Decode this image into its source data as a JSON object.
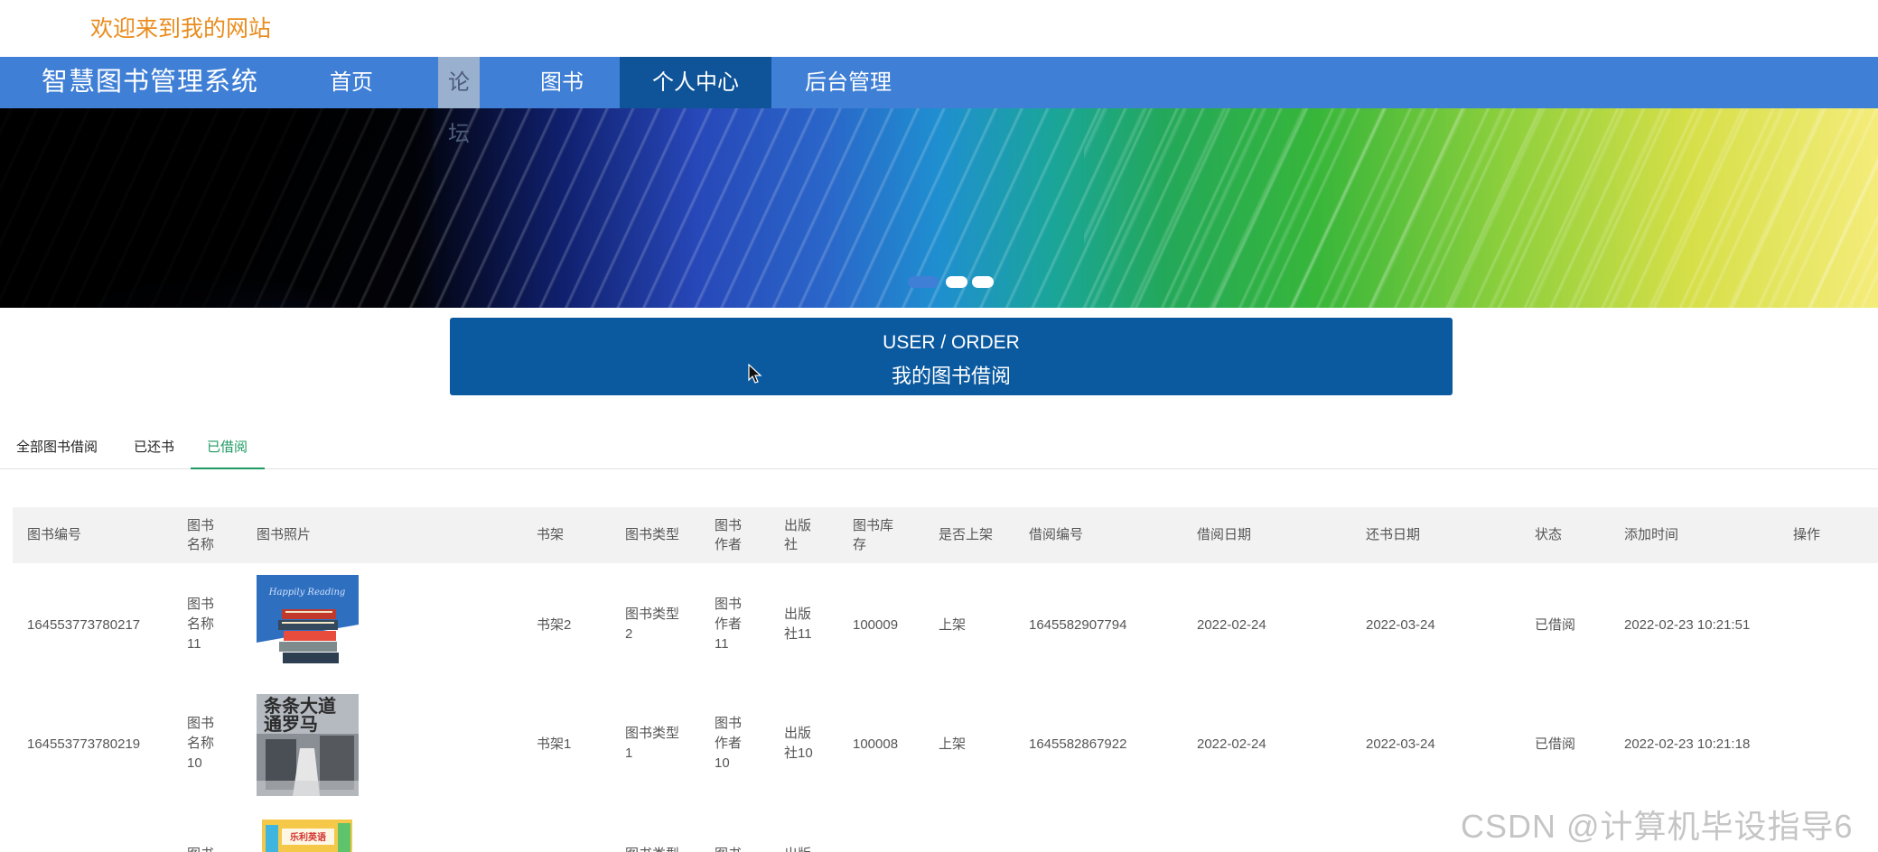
{
  "header": {
    "welcome": "欢迎来到我的网站"
  },
  "nav": {
    "brand": "智慧图书管理系统",
    "items": [
      {
        "label": "首页"
      },
      {
        "label": "论坛"
      },
      {
        "label": "图书"
      },
      {
        "label": "个人中心"
      },
      {
        "label": "后台管理"
      }
    ]
  },
  "colors": {
    "nav": "#3f7fd6",
    "nav_active": "#0f5499",
    "order_box": "#0b5aa0",
    "tab_active": "#1c9a60",
    "welcome": "#e98c1f"
  },
  "order": {
    "title_en": "USER / ORDER",
    "title_cn": "我的图书借阅"
  },
  "tabs": [
    {
      "label": "全部图书借阅"
    },
    {
      "label": "已还书"
    },
    {
      "label": "已借阅"
    }
  ],
  "table": {
    "headers": {
      "id": "图书编号",
      "name_l1": "图书",
      "name_l2": "名称",
      "photo": "图书照片",
      "shelf": "书架",
      "type": "图书类型",
      "author_l1": "图书",
      "author_l2": "作者",
      "publisher_l1": "出版",
      "publisher_l2": "社",
      "stock_l1": "图书库",
      "stock_l2": "存",
      "listed": "是否上架",
      "borrow_no": "借阅编号",
      "borrow_date": "借阅日期",
      "return_date": "还书日期",
      "status": "状态",
      "added": "添加时间",
      "ops": "操作"
    },
    "rows": [
      {
        "id": "164553773780217",
        "name": [
          "图书",
          "名称",
          "11"
        ],
        "shelf": "书架2",
        "type": [
          "图书类型",
          "2"
        ],
        "author": [
          "图书",
          "作者",
          "11"
        ],
        "publisher": [
          "出版",
          "社11"
        ],
        "stock": "100009",
        "listed": "上架",
        "borrow_no": "1645582907794",
        "borrow_date": "2022-02-24",
        "return_date": "2022-03-24",
        "status": "已借阅",
        "added": "2022-02-23 10:21:51"
      },
      {
        "id": "164553773780219",
        "name": [
          "图书",
          "名称",
          "10"
        ],
        "shelf": "书架1",
        "type": [
          "图书类型",
          "1"
        ],
        "author": [
          "图书",
          "作者",
          "10"
        ],
        "publisher": [
          "出版",
          "社10"
        ],
        "stock": "100008",
        "listed": "上架",
        "borrow_no": "1645582867922",
        "borrow_date": "2022-02-24",
        "return_date": "2022-03-24",
        "status": "已借阅",
        "added": "2022-02-23 10:21:18"
      },
      {
        "name": [
          "图书"
        ],
        "type": [
          "图书类型"
        ],
        "author": [
          "图书"
        ],
        "publisher": [
          "出版"
        ]
      }
    ]
  },
  "watermark": "CSDN @计算机毕设指导6"
}
